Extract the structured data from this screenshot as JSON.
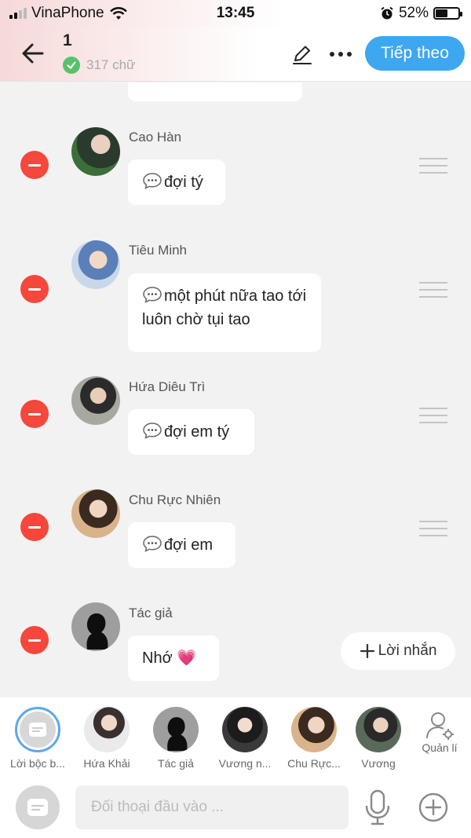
{
  "status_bar": {
    "carrier": "VinaPhone",
    "time": "13:45",
    "battery_percent": "52%",
    "battery_level": 0.52
  },
  "header": {
    "title": "1",
    "word_count": "317 chữ",
    "next_label": "Tiếp theo"
  },
  "messages": [
    {
      "name": "",
      "text": ""
    },
    {
      "name": "Cao Hàn",
      "text": "đợi tý"
    },
    {
      "name": "Tiêu Minh",
      "text": "một phút nữa tao tới luôn chờ tụi tao"
    },
    {
      "name": "Hứa Diêu Trì",
      "text": "đợi em tý"
    },
    {
      "name": "Chu Rực Nhiên",
      "text": "đợi em"
    },
    {
      "name": "Tác giả",
      "text": "Nhớ 💗"
    }
  ],
  "add_message_label": "Lời nhắn",
  "characters": [
    {
      "label": "Lời bộc b..."
    },
    {
      "label": "Hứa  Khải"
    },
    {
      "label": "Tác giả"
    },
    {
      "label": "Vương n..."
    },
    {
      "label": "Chu Rực..."
    },
    {
      "label": "Vương"
    }
  ],
  "manage_label": "Quản lí",
  "input": {
    "placeholder": "Đối thoại đầu vào ..."
  },
  "colors": {
    "accent": "#3da7f0",
    "remove": "#f5473c",
    "check": "#58c26a",
    "bg": "#f2f2f2"
  }
}
